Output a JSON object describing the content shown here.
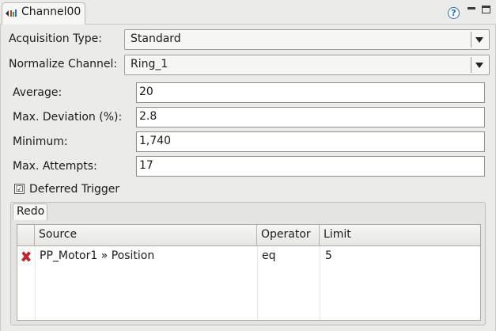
{
  "view": {
    "title": "Channel00",
    "icon": "channel-view-icon",
    "actions": [
      "help-icon",
      "minimize-icon",
      "maximize-icon"
    ]
  },
  "form": {
    "acquisition_type": {
      "label": "Acquisition Type:",
      "value": "Standard"
    },
    "normalize_channel": {
      "label": "Normalize Channel:",
      "value": "Ring_1"
    },
    "average": {
      "label": "Average:",
      "value": "20"
    },
    "max_deviation": {
      "label": "Max. Deviation (%):",
      "value": "2.8"
    },
    "minimum": {
      "label": "Minimum:",
      "value": "1,740"
    },
    "max_attempts": {
      "label": "Max. Attempts:",
      "value": "17"
    },
    "deferred_trigger": {
      "label": "Deferred Trigger",
      "checked": true,
      "mark": "☑"
    }
  },
  "redo": {
    "tab_label": "Redo",
    "columns": [
      "",
      "Source",
      "Operator",
      "Limit"
    ],
    "rows": [
      {
        "icon": "delete-x-icon",
        "source": "PP_Motor1 » Position",
        "operator": "eq",
        "limit": "5"
      }
    ]
  },
  "colors": {
    "background": "#ebebe9",
    "delete_icon": "#d6232a",
    "help_icon": "#2a6fbf"
  }
}
